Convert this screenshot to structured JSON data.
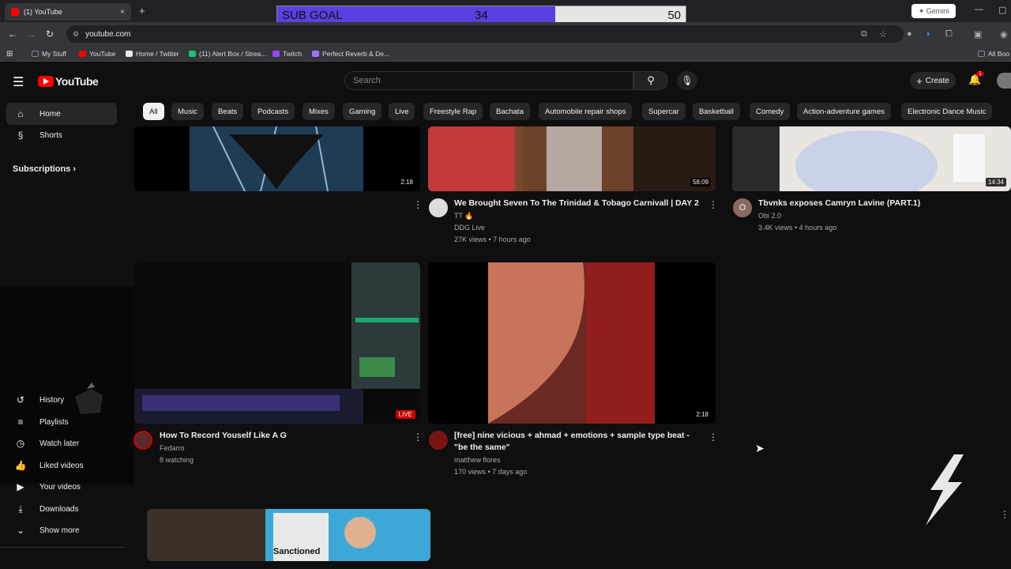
{
  "browser": {
    "tab_title": "(1) YouTube",
    "tab_close": "×",
    "new_tab": "+",
    "url": "youtube.com",
    "gemini_label": "Gemini",
    "bookmarks": [
      {
        "label": "My Stuff",
        "color": "#888888"
      },
      {
        "label": "YouTube",
        "color": "#ff0000"
      },
      {
        "label": "Home / Twitter",
        "color": "#e8eaed"
      },
      {
        "label": "(11) Alert Box / Strea...",
        "color": "#19c37d"
      },
      {
        "label": "Twitch",
        "color": "#9146ff"
      },
      {
        "label": "Perfect Reverb & De...",
        "color": "#a070ff"
      }
    ],
    "all_bookmarks": "All Boo"
  },
  "overlay": {
    "label": "SUB GOAL",
    "current": "34",
    "goal": "50",
    "progress": 0.68,
    "fill_color": "#5b3fe0"
  },
  "youtube": {
    "logo_text": "YouTube",
    "search_placeholder": "Search",
    "create_label": "Create",
    "notif_count": "1"
  },
  "sidebar": {
    "top_items": [
      {
        "label": "Home",
        "icon": "home-icon",
        "active": true
      },
      {
        "label": "Shorts",
        "icon": "shorts-icon",
        "active": false
      }
    ],
    "subscriptions_label": "Subscriptions",
    "bottom_items": [
      {
        "label": "History",
        "icon": "history-icon"
      },
      {
        "label": "Playlists",
        "icon": "playlists-icon"
      },
      {
        "label": "Watch later",
        "icon": "clock-icon"
      },
      {
        "label": "Liked videos",
        "icon": "thumbs-up-icon"
      },
      {
        "label": "Your videos",
        "icon": "video-icon"
      },
      {
        "label": "Downloads",
        "icon": "download-icon"
      },
      {
        "label": "Show more",
        "icon": "chevron-down-icon"
      }
    ]
  },
  "chips": [
    "All",
    "Music",
    "Beats",
    "Podcasts",
    "Mixes",
    "Gaming",
    "Live",
    "Freestyle Rap",
    "Bachata",
    "Automobile repair shops",
    "Supercar",
    "Basketball",
    "Comedy",
    "Action-adventure games",
    "Electronic Dance Music"
  ],
  "videos": [
    {
      "title": "",
      "channel": "",
      "meta": "",
      "duration": "2:18"
    },
    {
      "title": "We Brought Seven To The Trinidad & Tobago Carnivall | DAY 2",
      "subtitle": "TT 🔥",
      "channel": "DDG Live",
      "meta": "27K views • 7 hours ago",
      "duration": "58:09"
    },
    {
      "title": "Tbvnks exposes Camryn Lavine (PART.1)",
      "channel": "Obi 2.0",
      "meta": "3.4K views • 4 hours ago",
      "duration": "14:34",
      "avatar_letter": "O"
    },
    {
      "title": "How To Record Youself Like A G",
      "channel": "Fedarro",
      "meta": "8 watching",
      "duration": "LIVE"
    },
    {
      "title": "[free] nine vicious + ahmad + emotions + sample type beat - \"be the same\"",
      "channel": "matthew flores",
      "meta": "170 views • 7 days ago",
      "duration": "2:18"
    }
  ],
  "thumb_text": "Sanctioned"
}
